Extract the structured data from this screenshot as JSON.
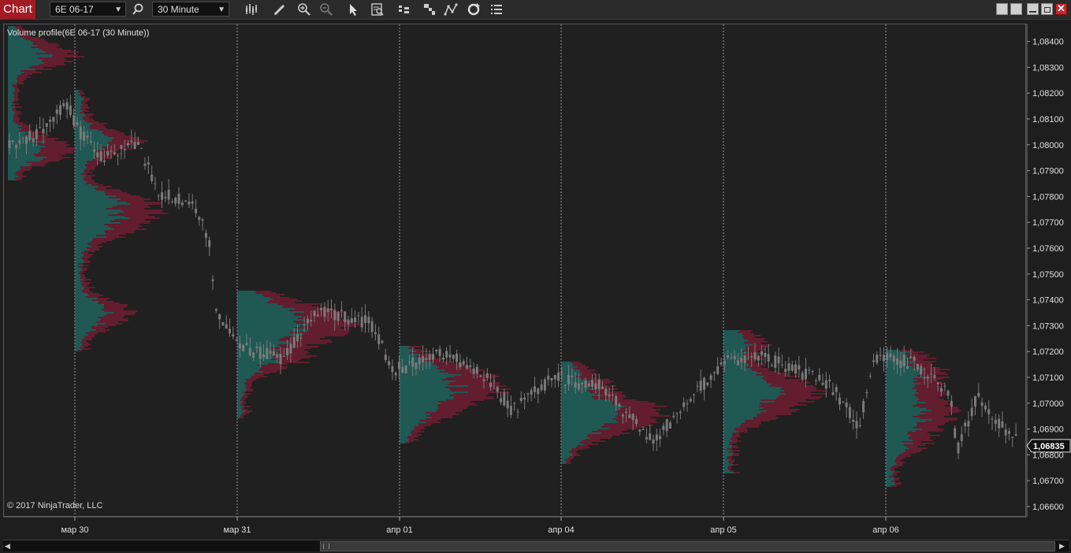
{
  "toolbar": {
    "tab_label": "Chart",
    "instrument": "6E 06-17",
    "timeframe": "30 Minute",
    "icons": [
      "search-icon",
      "bar-type-icon",
      "pencil-icon",
      "zoom-in-icon",
      "zoom-out-icon",
      "pointer-icon",
      "data-box-icon",
      "strategy-icon",
      "indicator-icon",
      "drawing-tools-icon",
      "reload-icon",
      "list-icon"
    ],
    "window_buttons": [
      "tile-icon",
      "tile-icon",
      "minimize-icon",
      "restore-icon",
      "close-icon"
    ]
  },
  "chart": {
    "indicator_label": "Volume profile(6E 06-17 (30 Minute))",
    "copyright": "© 2017 NinjaTrader, LLC",
    "current_price": "1,06835",
    "price_ticks": [
      "1,08400",
      "1,08300",
      "1,08200",
      "1,08100",
      "1,08000",
      "1,07900",
      "1,07800",
      "1,07700",
      "1,07600",
      "1,07500",
      "1,07400",
      "1,07300",
      "1,07200",
      "1,07100",
      "1,07000",
      "1,06900",
      "1,06800",
      "1,06700",
      "1,06600"
    ],
    "date_ticks": [
      "мар 30",
      "мар 31",
      "апр 01",
      "апр 04",
      "апр 05",
      "апр 06"
    ],
    "colors": {
      "background": "#202020",
      "candle": "#7a7a7a",
      "profile_up": "#1f8f86",
      "profile_down": "#a31a3c",
      "accent": "#a31a24"
    }
  }
}
